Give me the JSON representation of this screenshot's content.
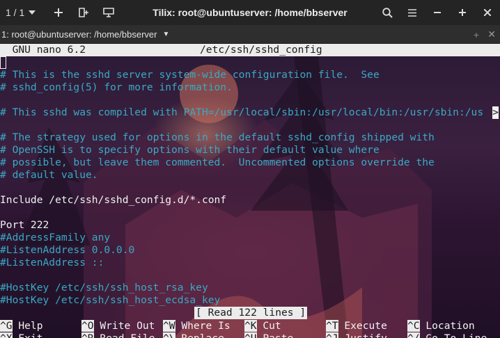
{
  "window": {
    "session_selector": "1 / 1",
    "title": "Tilix: root@ubuntuserver: /home/bbserver",
    "icons": {
      "session_dropdown": "chevron-down-icon",
      "add_terminal": "plus-icon",
      "split": "add-right-icon",
      "sync": "sync-input-icon",
      "search": "search-icon",
      "menu": "hamburger-menu-icon",
      "minimize": "minimize-icon",
      "maximize": "maximize-icon",
      "close": "close-icon"
    }
  },
  "terminal_header": {
    "title": "1: root@ubuntuserver: /home/bbserver",
    "icons": {
      "dropdown": "caret-down-icon",
      "add": "plus-icon",
      "close": "close-icon"
    }
  },
  "nano": {
    "version": "GNU nano 6.2",
    "filename": "/etc/ssh/sshd_config",
    "lines": [
      "# This is the sshd server system-wide configuration file.  See",
      "# sshd_config(5) for more information.",
      "",
      "# This sshd was compiled with PATH=/usr/local/sbin:/usr/local/bin:/usr/sbin:/us",
      "",
      "# The strategy used for options in the default sshd_config shipped with",
      "# OpenSSH is to specify options with their default value where",
      "# possible, but leave them commented.  Uncommented options override the",
      "# default value.",
      "",
      "Include /etc/ssh/sshd_config.d/*.conf",
      "",
      "Port 222",
      "#AddressFamily any",
      "#ListenAddress 0.0.0.0",
      "#ListenAddress ::",
      "",
      "#HostKey /etc/ssh/ssh_host_rsa_key",
      "#HostKey /etc/ssh/ssh_host_ecdsa_key"
    ],
    "wrap_marker": ">",
    "status": "[ Read 122 lines ]",
    "shortcuts_row1": [
      {
        "key": "^G",
        "label": "Help"
      },
      {
        "key": "^O",
        "label": "Write Out"
      },
      {
        "key": "^W",
        "label": "Where Is"
      },
      {
        "key": "^K",
        "label": "Cut"
      },
      {
        "key": "^T",
        "label": "Execute"
      },
      {
        "key": "^C",
        "label": "Location"
      }
    ],
    "shortcuts_row2": [
      {
        "key": "^X",
        "label": "Exit"
      },
      {
        "key": "^R",
        "label": "Read File"
      },
      {
        "key": "^\\",
        "label": "Replace"
      },
      {
        "key": "^U",
        "label": "Paste"
      },
      {
        "key": "^J",
        "label": "Justify"
      },
      {
        "key": "^/",
        "label": "Go To Line"
      }
    ]
  }
}
